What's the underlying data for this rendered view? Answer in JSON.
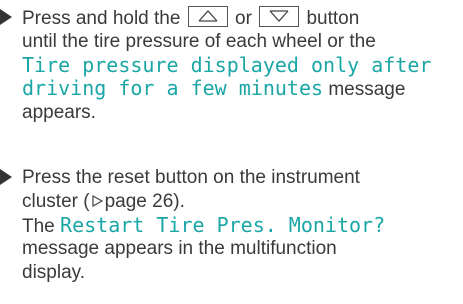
{
  "steps": [
    {
      "lines": {
        "l1_pre": "Press and hold the",
        "l1_or": "or",
        "l1_post": "button",
        "l2": "until the tire pressure of each wheel or the",
        "l3": "Tire pressure displayed only after",
        "l4": "driving for a few minutes",
        "l4_post": "message",
        "l5": "appears."
      },
      "icons": [
        "up-arrow-key-icon",
        "down-arrow-key-icon"
      ]
    },
    {
      "lines": {
        "l1": "Press the reset button on the instrument",
        "l2_pre": "cluster (",
        "l2_ref": "page 26).",
        "l3_pre": "The",
        "l3_disp": "Restart Tire Pres. Monitor?",
        "l4": "message appears in the multifunction",
        "l5": "display."
      }
    }
  ],
  "colors": {
    "text": "#3a3a3a",
    "display_message": "#1ba6a6"
  }
}
